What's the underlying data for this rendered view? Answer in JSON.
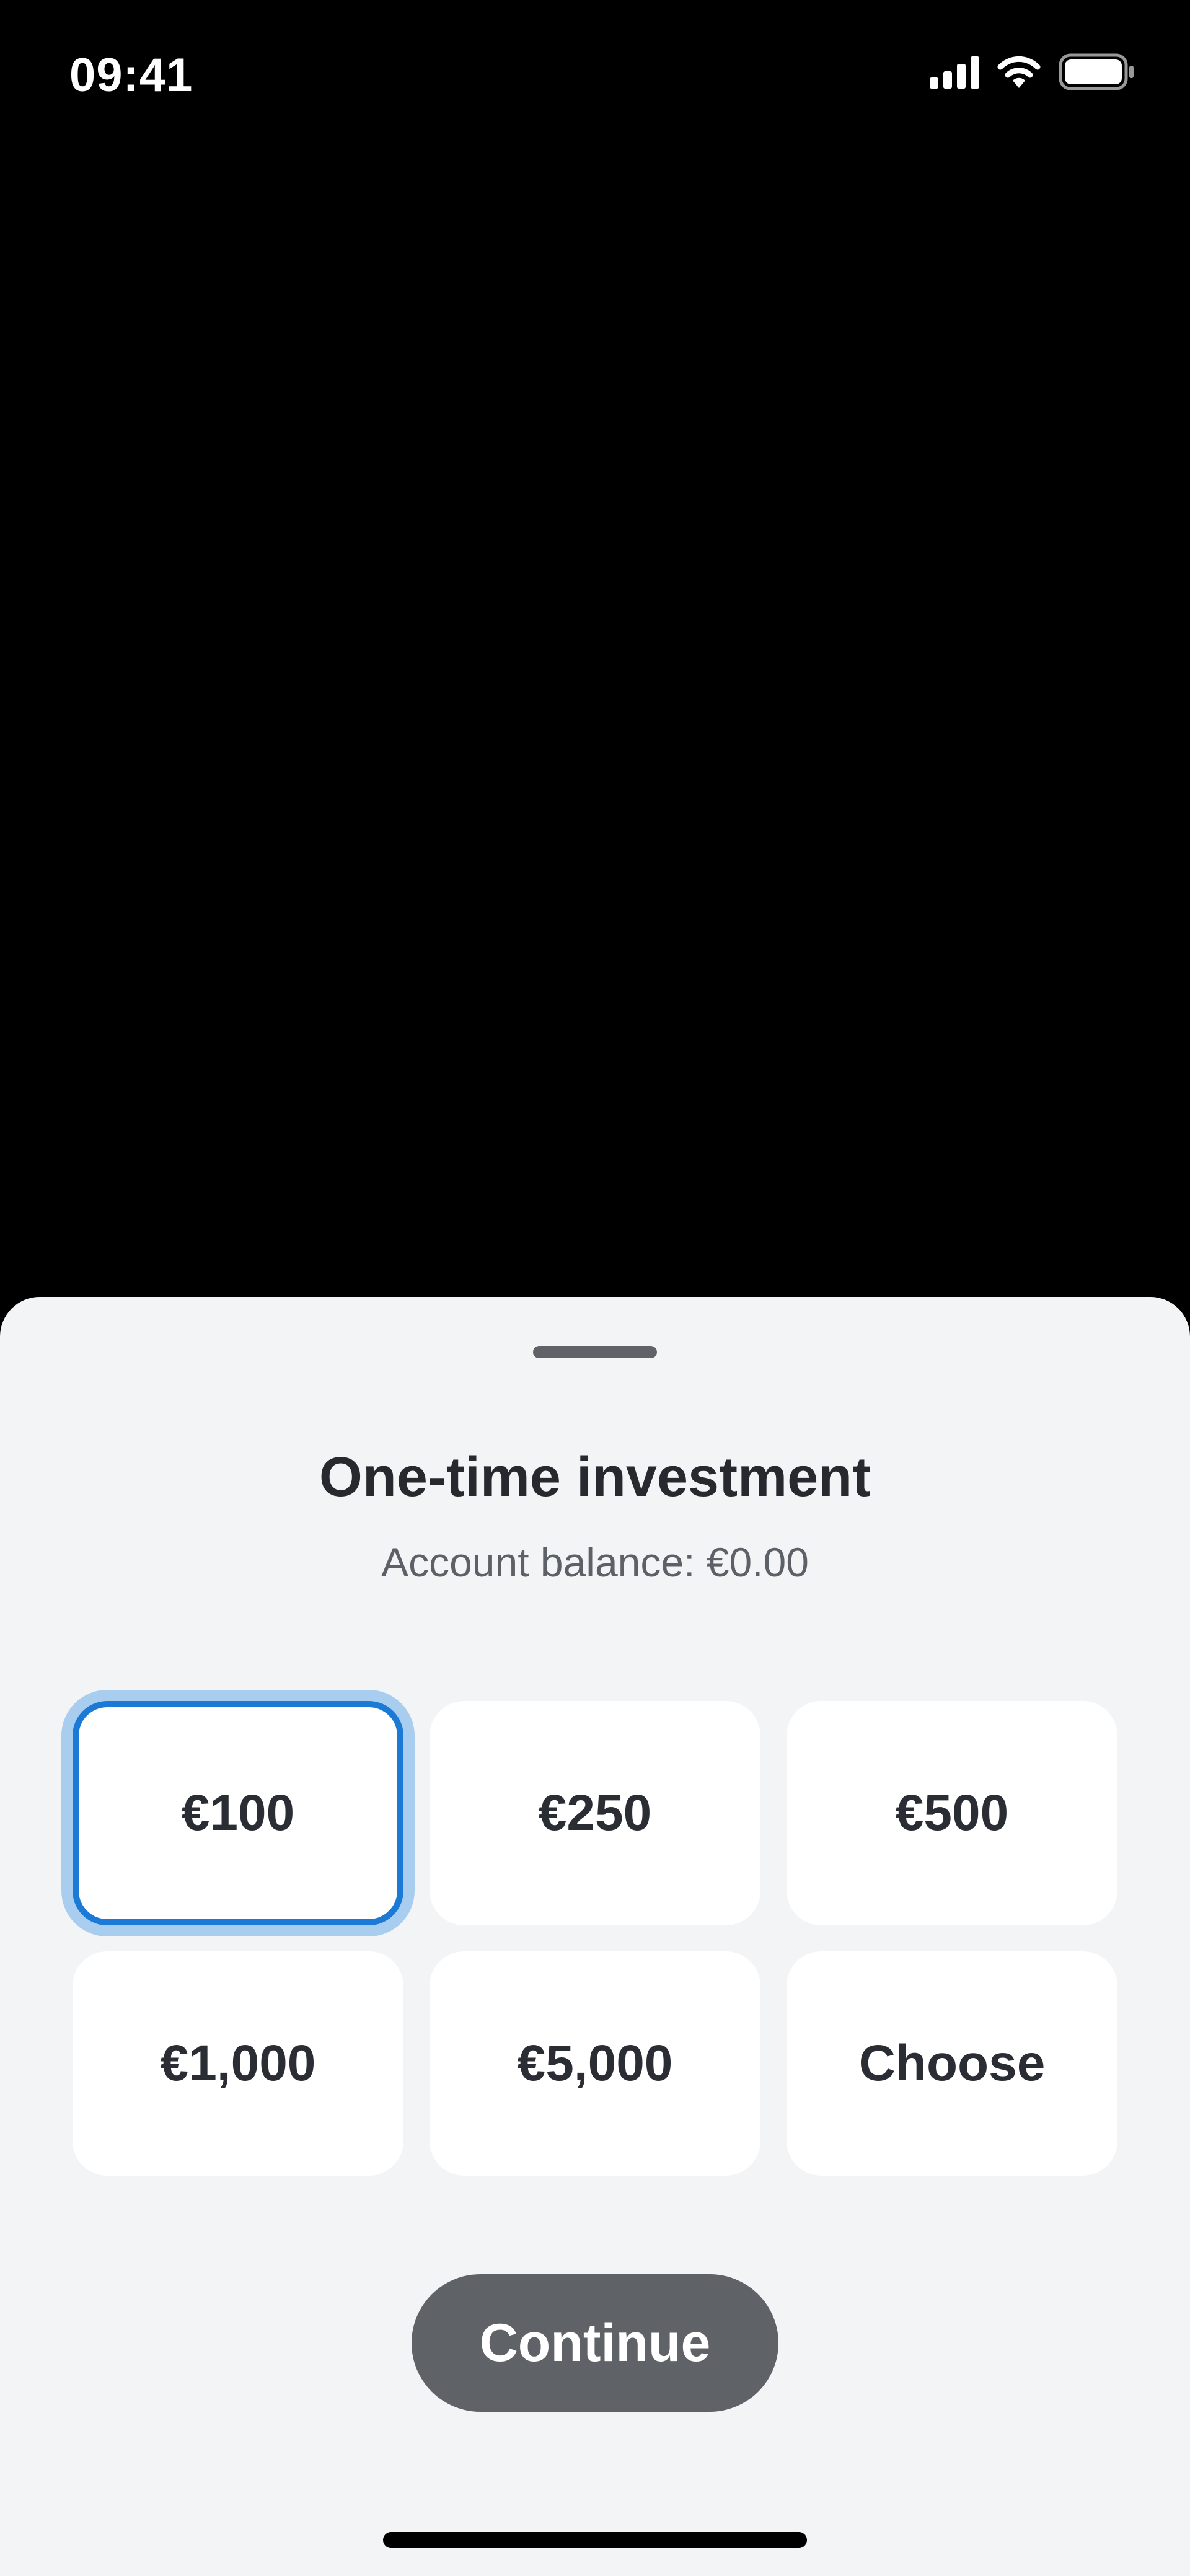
{
  "status_bar": {
    "time": "09:41",
    "icons": [
      "cellular-signal-icon",
      "wifi-icon",
      "battery-icon"
    ]
  },
  "sheet": {
    "title": "One-time investment",
    "subtitle": "Account balance: €0.00",
    "options": [
      {
        "label": "€100",
        "selected": true
      },
      {
        "label": "€250",
        "selected": false
      },
      {
        "label": "€500",
        "selected": false
      },
      {
        "label": "€1,000",
        "selected": false
      },
      {
        "label": "€5,000",
        "selected": false
      },
      {
        "label": "Choose",
        "selected": false
      }
    ],
    "continue_label": "Continue"
  },
  "colors": {
    "sheet_background": "#f3f4f6",
    "selected_border": "#1a7ad6",
    "selected_glow": "#a9cdef",
    "button_background": "#5f6368"
  }
}
